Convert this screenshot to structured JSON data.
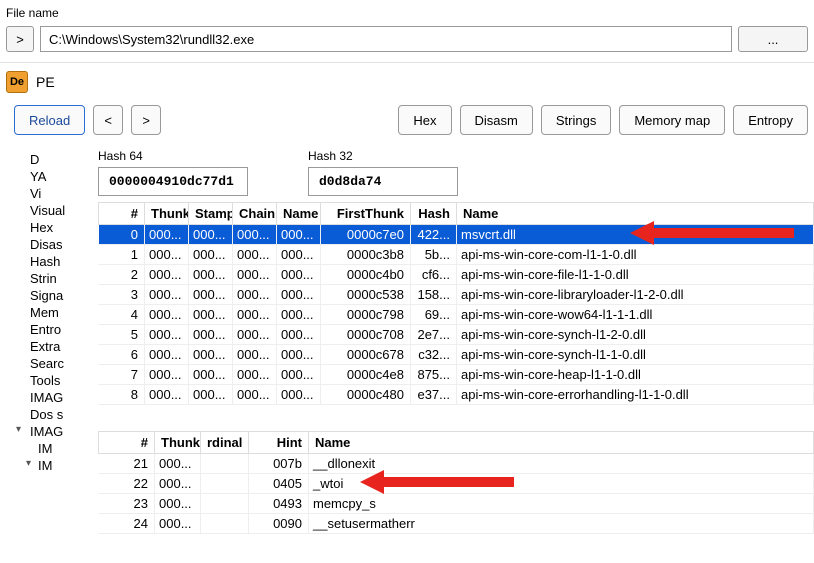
{
  "file": {
    "label": "File name",
    "toggle": ">",
    "path": "C:\\Windows\\System32\\rundll32.exe",
    "browse": "..."
  },
  "pe": {
    "icon": "De",
    "title": "PE"
  },
  "toolbar": {
    "reload": "Reload",
    "prev": "<",
    "next": ">",
    "hex": "Hex",
    "disasm": "Disasm",
    "strings": "Strings",
    "memmap": "Memory map",
    "entropy": "Entropy"
  },
  "sidebar": {
    "items": [
      "D",
      "YA",
      "Vi",
      "Visual",
      "Hex",
      "Disas",
      "Hash",
      "Strin",
      "Signa",
      "Mem",
      "Entro",
      "Extra",
      "Searc",
      "Tools",
      "IMAG",
      "Dos s",
      "IMAG",
      "IM",
      "IM"
    ]
  },
  "hash": {
    "label64": "Hash 64",
    "val64": "0000004910dc77d1",
    "label32": "Hash 32",
    "val32": "d0d8da74"
  },
  "imports": {
    "headers": [
      "#",
      "Thunk",
      "Stamp",
      "Chain",
      "Name",
      "FirstThunk",
      "Hash",
      "Name"
    ],
    "rows": [
      {
        "idx": "0",
        "thunk": "000...",
        "stamp": "000...",
        "chain": "000...",
        "name1": "000...",
        "first": "0000c7e0",
        "hash": "422...",
        "name2": "msvcrt.dll"
      },
      {
        "idx": "1",
        "thunk": "000...",
        "stamp": "000...",
        "chain": "000...",
        "name1": "000...",
        "first": "0000c3b8",
        "hash": "5b...",
        "name2": "api-ms-win-core-com-l1-1-0.dll"
      },
      {
        "idx": "2",
        "thunk": "000...",
        "stamp": "000...",
        "chain": "000...",
        "name1": "000...",
        "first": "0000c4b0",
        "hash": "cf6...",
        "name2": "api-ms-win-core-file-l1-1-0.dll"
      },
      {
        "idx": "3",
        "thunk": "000...",
        "stamp": "000...",
        "chain": "000...",
        "name1": "000...",
        "first": "0000c538",
        "hash": "158...",
        "name2": "api-ms-win-core-libraryloader-l1-2-0.dll"
      },
      {
        "idx": "4",
        "thunk": "000...",
        "stamp": "000...",
        "chain": "000...",
        "name1": "000...",
        "first": "0000c798",
        "hash": "69...",
        "name2": "api-ms-win-core-wow64-l1-1-1.dll"
      },
      {
        "idx": "5",
        "thunk": "000...",
        "stamp": "000...",
        "chain": "000...",
        "name1": "000...",
        "first": "0000c708",
        "hash": "2e7...",
        "name2": "api-ms-win-core-synch-l1-2-0.dll"
      },
      {
        "idx": "6",
        "thunk": "000...",
        "stamp": "000...",
        "chain": "000...",
        "name1": "000...",
        "first": "0000c678",
        "hash": "c32...",
        "name2": "api-ms-win-core-synch-l1-1-0.dll"
      },
      {
        "idx": "7",
        "thunk": "000...",
        "stamp": "000...",
        "chain": "000...",
        "name1": "000...",
        "first": "0000c4e8",
        "hash": "875...",
        "name2": "api-ms-win-core-heap-l1-1-0.dll"
      },
      {
        "idx": "8",
        "thunk": "000...",
        "stamp": "000...",
        "chain": "000...",
        "name1": "000...",
        "first": "0000c480",
        "hash": "e37...",
        "name2": "api-ms-win-core-errorhandling-l1-1-0.dll"
      }
    ]
  },
  "funcs": {
    "headers": [
      "#",
      "Thunk",
      "rdinal",
      "Hint",
      "Name"
    ],
    "rows": [
      {
        "idx": "21",
        "thunk": "000...",
        "ord": "",
        "hint": "007b",
        "name": "__dllonexit"
      },
      {
        "idx": "22",
        "thunk": "000...",
        "ord": "",
        "hint": "0405",
        "name": "_wtoi"
      },
      {
        "idx": "23",
        "thunk": "000...",
        "ord": "",
        "hint": "0493",
        "name": "memcpy_s"
      },
      {
        "idx": "24",
        "thunk": "000...",
        "ord": "",
        "hint": "0090",
        "name": "__setusermatherr"
      }
    ]
  }
}
